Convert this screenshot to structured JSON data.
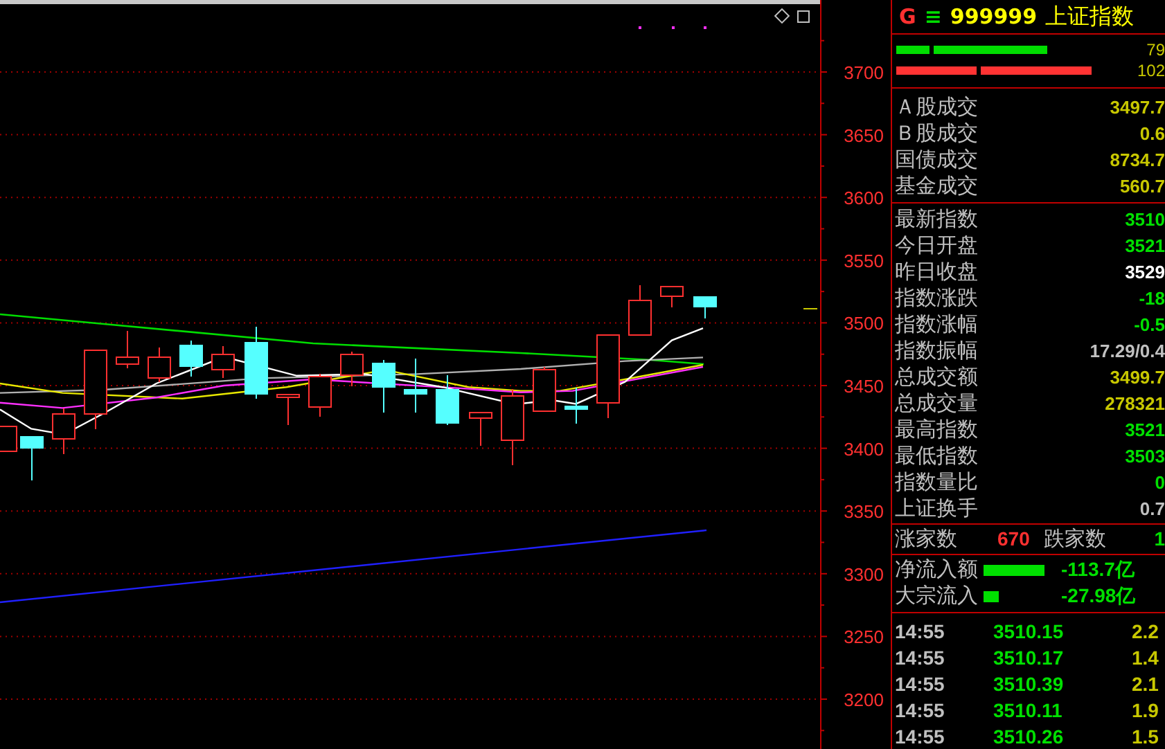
{
  "chart": {
    "price_axis": [
      "3700",
      "3650",
      "3600",
      "3550",
      "3500",
      "3450",
      "3400",
      "3350",
      "3300",
      "3250",
      "3200"
    ]
  },
  "quote": {
    "marker": "G",
    "menu": "≡",
    "code": "999999",
    "name": "上证指数"
  },
  "ratio_bars": [
    {
      "color": "#00dd00",
      "value": "79"
    },
    {
      "color": "#ff3333",
      "value": "102"
    }
  ],
  "turnover": [
    {
      "label": "Ａ股成交",
      "value": "3497.7",
      "color": "#c8c800"
    },
    {
      "label": "Ｂ股成交",
      "value": "0.6",
      "color": "#c8c800"
    },
    {
      "label": "国债成交",
      "value": "8734.7",
      "color": "#c8c800"
    },
    {
      "label": "基金成交",
      "value": "560.7",
      "color": "#c8c800"
    }
  ],
  "stats": [
    {
      "label": "最新指数",
      "value": "3510",
      "color": "#00e000"
    },
    {
      "label": "今日开盘",
      "value": "3521",
      "color": "#00e000"
    },
    {
      "label": "昨日收盘",
      "value": "3529",
      "color": "#ffffff"
    },
    {
      "label": "指数涨跌",
      "value": "-18",
      "color": "#00e000"
    },
    {
      "label": "指数涨幅",
      "value": "-0.5",
      "color": "#00e000"
    },
    {
      "label": "指数振幅",
      "value": "17.29/0.4",
      "color": "#c0c0c0"
    },
    {
      "label": "总成交额",
      "value": "3499.7",
      "color": "#c8c800"
    },
    {
      "label": "总成交量",
      "value": "278321",
      "color": "#c8c800"
    },
    {
      "label": "最高指数",
      "value": "3521",
      "color": "#00e000"
    },
    {
      "label": "最低指数",
      "value": "3503",
      "color": "#00e000"
    },
    {
      "label": "指数量比",
      "value": "0",
      "color": "#00e000"
    },
    {
      "label": "上证换手",
      "value": "0.7",
      "color": "#c0c0c0"
    }
  ],
  "breadth": {
    "up_label": "涨家数",
    "up_count": "670",
    "down_label": "跌家数",
    "down_count": "1"
  },
  "flows": [
    {
      "label": "净流入额",
      "value": "-113.7亿"
    },
    {
      "label": "大宗流入",
      "value": "-27.98亿"
    }
  ],
  "ticks": [
    {
      "time": "14:55",
      "price": "3510.15",
      "volume": "2.2"
    },
    {
      "time": "14:55",
      "price": "3510.17",
      "volume": "1.4"
    },
    {
      "time": "14:55",
      "price": "3510.39",
      "volume": "2.1"
    },
    {
      "time": "14:55",
      "price": "3510.11",
      "volume": "1.9"
    },
    {
      "time": "14:55",
      "price": "3510.26",
      "volume": "1.5"
    }
  ]
}
